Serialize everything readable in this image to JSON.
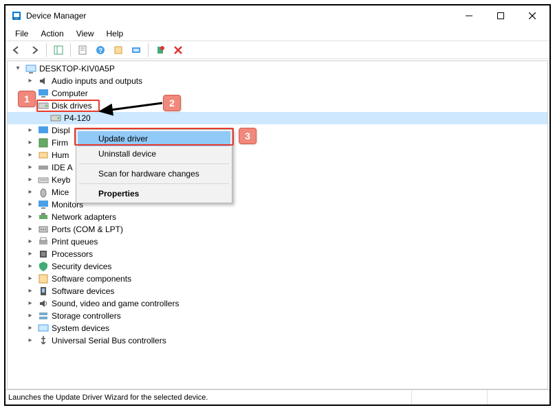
{
  "window": {
    "title": "Device Manager"
  },
  "menu": {
    "file": "File",
    "action": "Action",
    "view": "View",
    "help": "Help"
  },
  "tree": {
    "root": {
      "label": "DESKTOP-KIV0A5P"
    },
    "audio": "Audio inputs and outputs",
    "computer": "Computer",
    "diskdrives": "Disk drives",
    "p4120": "P4-120",
    "display": "Displ",
    "firmware": "Firm",
    "hid": "Hum",
    "ide": "IDE A",
    "keyboards": "Keyb",
    "mice": "Mice",
    "monitors": "Monitors",
    "network": "Network adapters",
    "ports": "Ports (COM & LPT)",
    "printqueues": "Print queues",
    "processors": "Processors",
    "security": "Security devices",
    "softcomp": "Software components",
    "softdev": "Software devices",
    "sound": "Sound, video and game controllers",
    "storage": "Storage controllers",
    "system": "System devices",
    "usb": "Universal Serial Bus controllers"
  },
  "context_menu": {
    "update": "Update driver",
    "uninstall": "Uninstall device",
    "scan": "Scan for hardware changes",
    "properties": "Properties"
  },
  "status": {
    "text": "Launches the Update Driver Wizard for the selected device."
  },
  "annotations": {
    "one": "1",
    "two": "2",
    "three": "3"
  }
}
